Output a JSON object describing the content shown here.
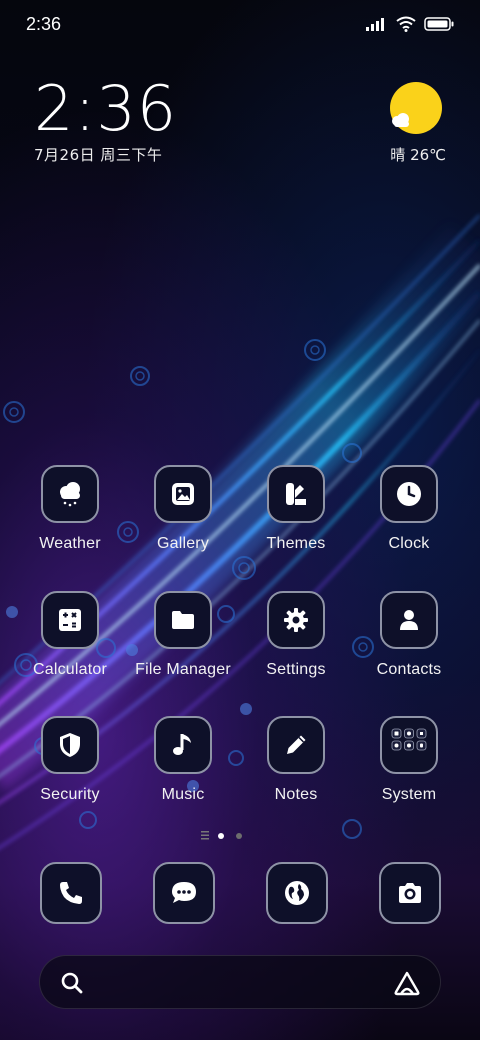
{
  "status_bar": {
    "time": "2:36",
    "icons": [
      "signal-icon",
      "wifi-icon",
      "battery-icon"
    ]
  },
  "clock_widget": {
    "time": "2:36",
    "date": "7月26日 周三下午"
  },
  "weather_widget": {
    "condition_icon": "sun-with-cloud-icon",
    "text": "晴 26℃"
  },
  "apps": [
    {
      "label": "Weather",
      "icon": "weather-cloud-icon"
    },
    {
      "label": "Gallery",
      "icon": "gallery-icon"
    },
    {
      "label": "Themes",
      "icon": "themes-icon"
    },
    {
      "label": "Clock",
      "icon": "clock-icon"
    },
    {
      "label": "Calculator",
      "icon": "calculator-icon"
    },
    {
      "label": "File Manager",
      "icon": "folder-icon"
    },
    {
      "label": "Settings",
      "icon": "gear-icon"
    },
    {
      "label": "Contacts",
      "icon": "contact-icon"
    },
    {
      "label": "Security",
      "icon": "shield-icon"
    },
    {
      "label": "Music",
      "icon": "music-note-icon"
    },
    {
      "label": "Notes",
      "icon": "pencil-icon"
    },
    {
      "label": "System",
      "icon": "folder-grid-icon"
    }
  ],
  "page_indicator": {
    "pages": 2,
    "current": 1
  },
  "dock": [
    {
      "icon": "phone-icon"
    },
    {
      "icon": "message-icon"
    },
    {
      "icon": "browser-globe-icon"
    },
    {
      "icon": "camera-icon"
    }
  ],
  "search_bar": {
    "left_icon": "search-icon",
    "right_icon": "assistant-icon"
  },
  "colors": {
    "icon_background": "#0e1029",
    "icon_border": "#8e93a6",
    "weather_sun": "#fad21a"
  }
}
